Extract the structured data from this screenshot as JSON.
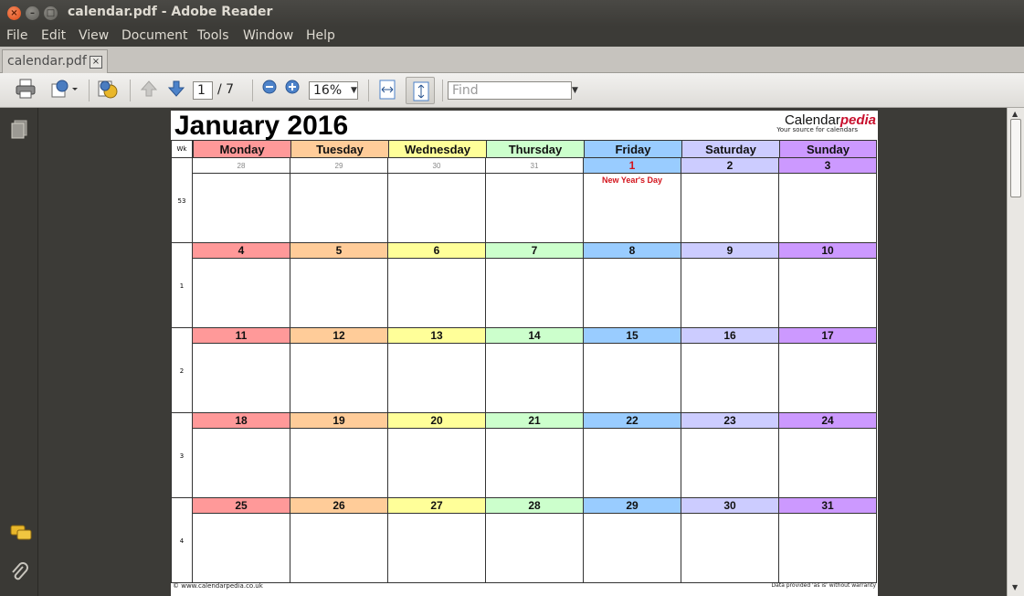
{
  "window": {
    "title": "calendar.pdf - Adobe Reader"
  },
  "menu": [
    "File",
    "Edit",
    "View",
    "Document",
    "Tools",
    "Window",
    "Help"
  ],
  "tab": {
    "label": "calendar.pdf"
  },
  "toolbar": {
    "page_current": "1",
    "page_total": "/ 7",
    "zoom": "16%",
    "find_placeholder": "Find"
  },
  "calendar": {
    "title": "January 2016",
    "logo_main": "Calendar",
    "logo_accent": "pedia",
    "tagline": "Your source for calendars",
    "wk_label": "Wk",
    "days": [
      {
        "label": "Monday",
        "color": "#ff9999"
      },
      {
        "label": "Tuesday",
        "color": "#ffcc99"
      },
      {
        "label": "Wednesday",
        "color": "#ffff99"
      },
      {
        "label": "Thursday",
        "color": "#ccffcc"
      },
      {
        "label": "Friday",
        "color": "#99ccff"
      },
      {
        "label": "Saturday",
        "color": "#ccccff"
      },
      {
        "label": "Sunday",
        "color": "#cc99ff"
      }
    ],
    "weeks": [
      {
        "wk": "53",
        "dates": [
          "28",
          "29",
          "30",
          "31",
          "1",
          "2",
          "3"
        ],
        "dim": [
          true,
          true,
          true,
          true,
          false,
          false,
          false
        ]
      },
      {
        "wk": "1",
        "dates": [
          "4",
          "5",
          "6",
          "7",
          "8",
          "9",
          "10"
        ],
        "dim": [
          false,
          false,
          false,
          false,
          false,
          false,
          false
        ]
      },
      {
        "wk": "2",
        "dates": [
          "11",
          "12",
          "13",
          "14",
          "15",
          "16",
          "17"
        ],
        "dim": [
          false,
          false,
          false,
          false,
          false,
          false,
          false
        ]
      },
      {
        "wk": "3",
        "dates": [
          "18",
          "19",
          "20",
          "21",
          "22",
          "23",
          "24"
        ],
        "dim": [
          false,
          false,
          false,
          false,
          false,
          false,
          false
        ]
      },
      {
        "wk": "4",
        "dates": [
          "25",
          "26",
          "27",
          "28",
          "29",
          "30",
          "31"
        ],
        "dim": [
          false,
          false,
          false,
          false,
          false,
          false,
          false
        ]
      }
    ],
    "holiday": {
      "week": 0,
      "day": 4,
      "label": "New Year's Day",
      "color": "#d3141c"
    },
    "footer_left": "© www.calendarpedia.co.uk",
    "footer_right": "Data provided 'as is' without warranty"
  }
}
